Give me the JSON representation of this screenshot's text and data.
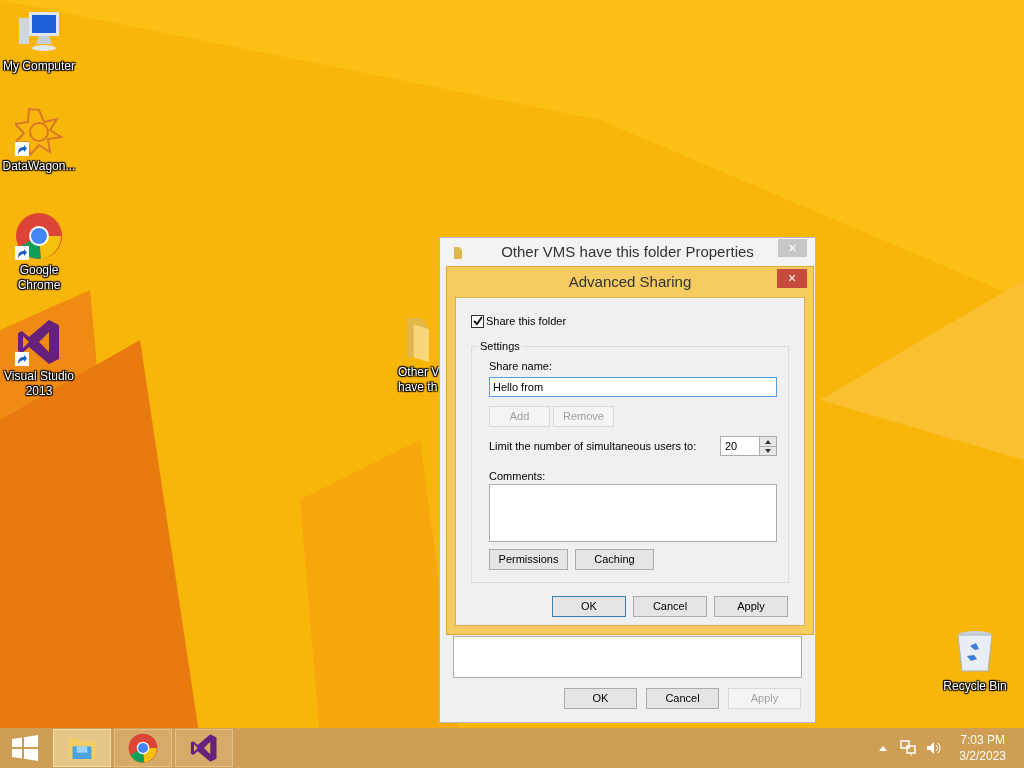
{
  "desktop_icons": [
    {
      "kind": "computer",
      "label_lines": [
        "My Computer"
      ],
      "shortcut": false
    },
    {
      "kind": "star",
      "label_lines": [
        "DataWagon..."
      ],
      "shortcut": true
    },
    {
      "kind": "chrome",
      "label_lines": [
        "Google",
        "Chrome"
      ],
      "shortcut": true
    },
    {
      "kind": "vs",
      "label_lines": [
        "Visual Studio",
        "2013"
      ],
      "shortcut": true
    },
    {
      "kind": "folder",
      "label_lines": [
        "Other V",
        "have th"
      ],
      "shortcut": false
    },
    {
      "kind": "bin",
      "label_lines": [
        "Recycle Bin"
      ],
      "shortcut": false
    }
  ],
  "properties_window": {
    "title": "Other VMS have this folder Properties",
    "close": "×",
    "buttons": [
      {
        "label": "OK",
        "disabled": false
      },
      {
        "label": "Cancel",
        "disabled": false
      },
      {
        "label": "Apply",
        "disabled": true
      }
    ]
  },
  "advanced_sharing": {
    "title": "Advanced Sharing",
    "close": "×",
    "share_checkbox": {
      "label": "Share this folder",
      "checked": true
    },
    "settings_group": "Settings",
    "share_name_label": "Share name:",
    "share_name_value": "Hello from ",
    "share_buttons": [
      {
        "label": "Add",
        "disabled": true
      },
      {
        "label": "Remove",
        "disabled": true
      }
    ],
    "limit_label": "Limit the number of simultaneous users to:",
    "limit_value": "20",
    "comments_label": "Comments:",
    "group_buttons": [
      {
        "label": "Permissions",
        "disabled": false
      },
      {
        "label": "Caching",
        "disabled": false
      }
    ],
    "buttons": [
      {
        "label": "OK",
        "default": true
      },
      {
        "label": "Cancel",
        "default": false
      },
      {
        "label": "Apply",
        "default": false
      }
    ]
  },
  "taskbar": {
    "items": [
      {
        "kind": "explorer",
        "active": true
      },
      {
        "kind": "chrome",
        "active": false
      },
      {
        "kind": "vs",
        "active": false
      }
    ],
    "time": "7:03 PM",
    "date": "3/2/2023"
  }
}
